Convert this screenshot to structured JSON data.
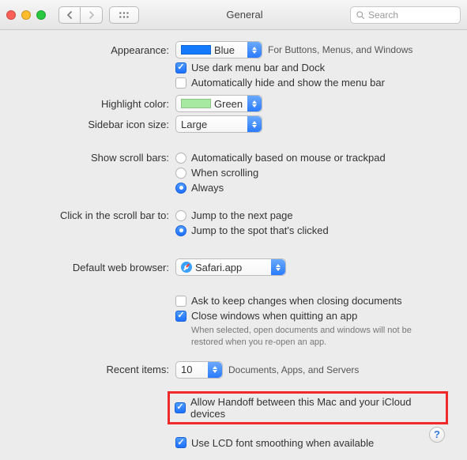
{
  "window": {
    "title": "General"
  },
  "search": {
    "placeholder": "Search"
  },
  "appearance": {
    "label": "Appearance:",
    "value": "Blue",
    "hint": "For Buttons, Menus, and Windows",
    "dark_menu_bar": {
      "checked": true,
      "label": "Use dark menu bar and Dock"
    },
    "auto_hide": {
      "checked": false,
      "label": "Automatically hide and show the menu bar"
    }
  },
  "highlight": {
    "label": "Highlight color:",
    "value": "Green"
  },
  "sidebar": {
    "label": "Sidebar icon size:",
    "value": "Large"
  },
  "scrollbars": {
    "label": "Show scroll bars:",
    "options": [
      {
        "label": "Automatically based on mouse or trackpad",
        "checked": false
      },
      {
        "label": "When scrolling",
        "checked": false
      },
      {
        "label": "Always",
        "checked": true
      }
    ]
  },
  "click_scroll": {
    "label": "Click in the scroll bar to:",
    "options": [
      {
        "label": "Jump to the next page",
        "checked": false
      },
      {
        "label": "Jump to the spot that's clicked",
        "checked": true
      }
    ]
  },
  "browser": {
    "label": "Default web browser:",
    "value": "Safari.app"
  },
  "documents": {
    "ask_keep": {
      "checked": false,
      "label": "Ask to keep changes when closing documents"
    },
    "close_win": {
      "checked": true,
      "label": "Close windows when quitting an app"
    },
    "close_win_hint": "When selected, open documents and windows will not be restored when you re-open an app."
  },
  "recent": {
    "label": "Recent items:",
    "value": "10",
    "suffix": "Documents, Apps, and Servers"
  },
  "handoff": {
    "checked": true,
    "label": "Allow Handoff between this Mac and your iCloud devices"
  },
  "lcd": {
    "checked": true,
    "label": "Use LCD font smoothing when available"
  }
}
